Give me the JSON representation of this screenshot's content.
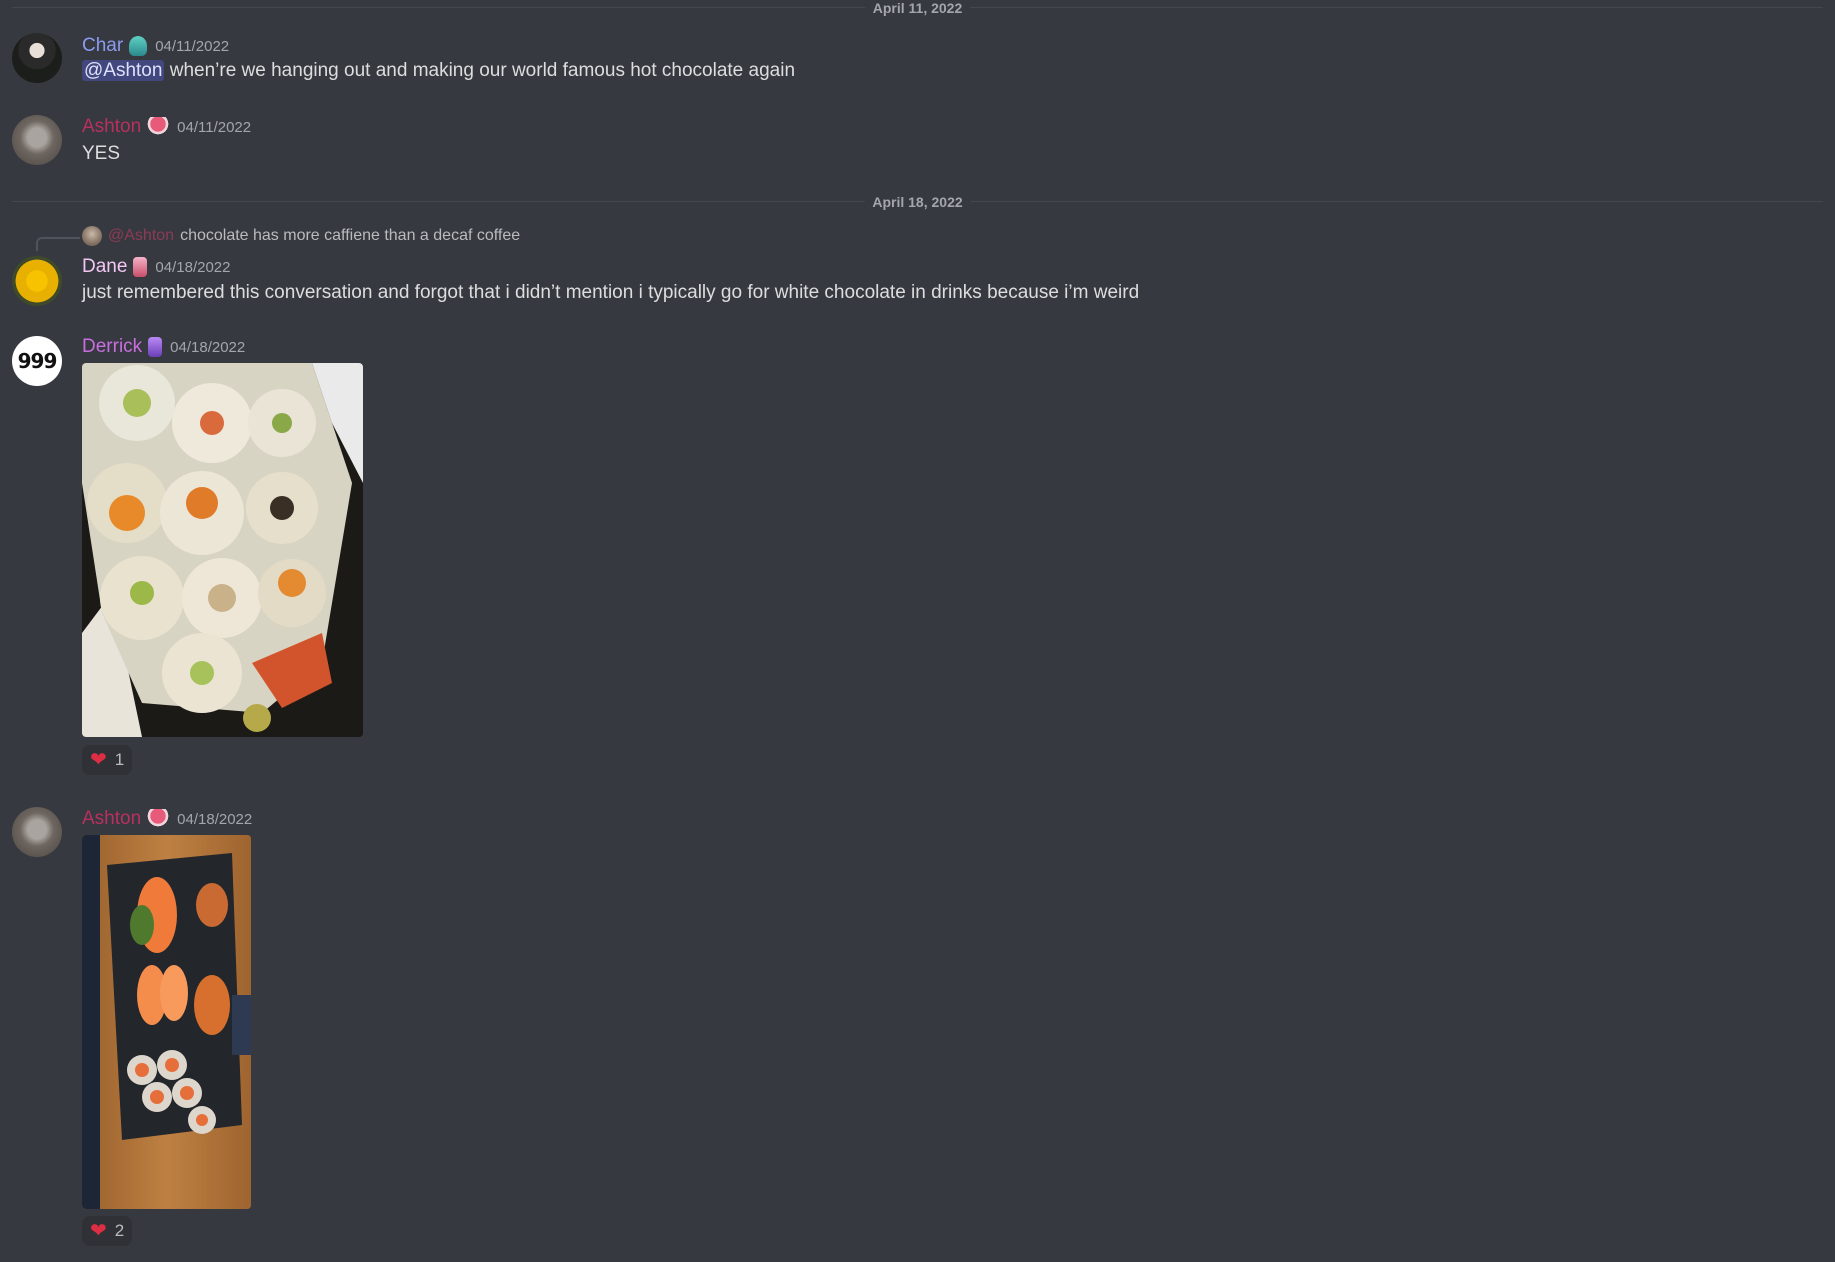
{
  "dividers": [
    {
      "label": "April 11, 2022"
    },
    {
      "label": "April 18, 2022"
    }
  ],
  "messages": [
    {
      "author": "Char",
      "author_color": "#8b9bf0",
      "timestamp": "04/11/2022",
      "mention": "@Ashton",
      "text": "when’re we hanging out and making our world famous hot chocolate again"
    },
    {
      "author": "Ashton",
      "author_color": "#b8305f",
      "timestamp": "04/11/2022",
      "text": "YES"
    },
    {
      "reply": {
        "mention": "@Ashton",
        "text": "chocolate has more caffiene than a decaf coffee"
      },
      "author": "Dane",
      "author_color": "#f3c6f3",
      "timestamp": "04/18/2022",
      "text": "just remembered this conversation and forgot that i didn’t mention i typically go for white chocolate in drinks because i’m weird"
    },
    {
      "author": "Derrick",
      "author_color": "#c86ee0",
      "avatar_text": "999",
      "timestamp": "04/18/2022",
      "attachment": "sushi-rolls-image",
      "reaction": {
        "emoji": "heart",
        "count": "1"
      }
    },
    {
      "author": "Ashton",
      "author_color": "#b8305f",
      "timestamp": "04/18/2022",
      "attachment": "sashimi-platter-image",
      "reaction": {
        "emoji": "heart",
        "count": "2"
      }
    }
  ]
}
